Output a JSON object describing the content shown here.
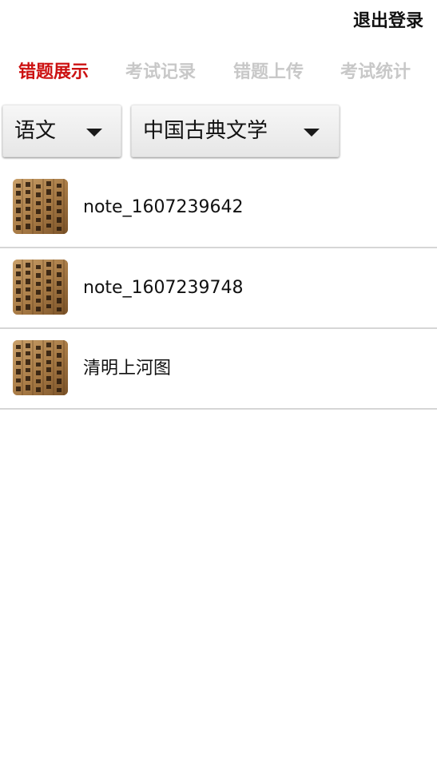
{
  "header": {
    "logout_label": "退出登录"
  },
  "tabs": [
    {
      "label": "错题展示",
      "active": true
    },
    {
      "label": "考试记录",
      "active": false
    },
    {
      "label": "错题上传",
      "active": false
    },
    {
      "label": "考试统计",
      "active": false
    }
  ],
  "filters": {
    "subject": {
      "selected": "语文"
    },
    "category": {
      "selected": "中国古典文学"
    }
  },
  "notes": [
    {
      "title": "note_1607239642",
      "thumbnail": "ancient-text-image"
    },
    {
      "title": "note_1607239748",
      "thumbnail": "ancient-text-image"
    },
    {
      "title": "清明上河图",
      "thumbnail": "ancient-text-image"
    }
  ],
  "colors": {
    "active_tab": "#cc1111",
    "inactive_tab": "#c8c8c8",
    "divider": "#d6d6d6"
  },
  "icons": {
    "dropdown": "triangle-down-icon"
  }
}
